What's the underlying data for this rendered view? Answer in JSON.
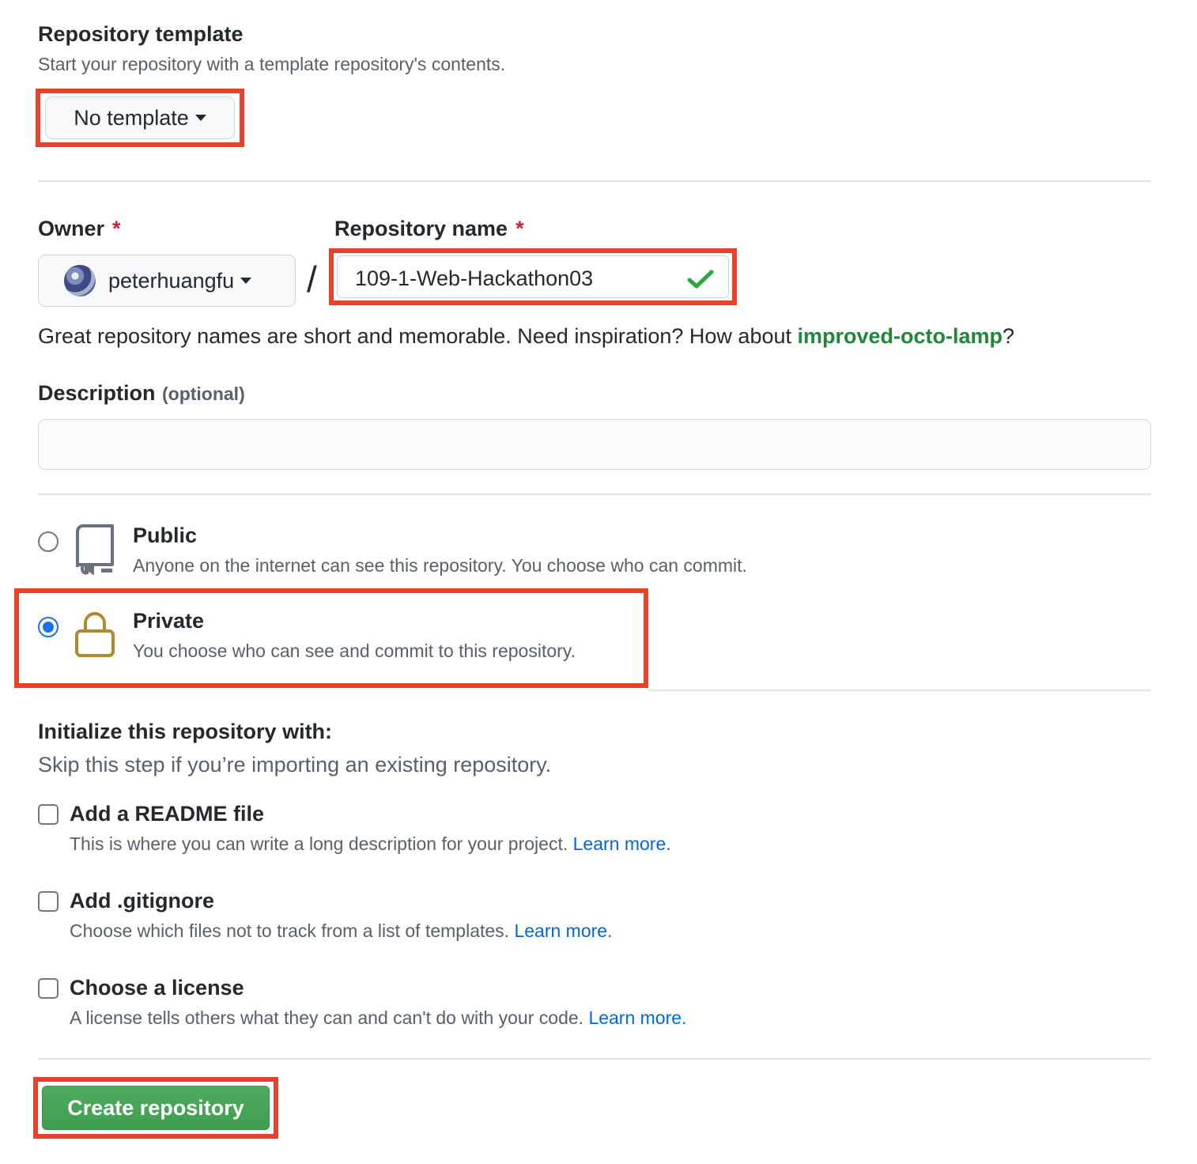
{
  "template_section": {
    "title": "Repository template",
    "description": "Start your repository with a template repository's contents.",
    "dropdown_label": "No template"
  },
  "owner": {
    "label": "Owner",
    "required_mark": "*",
    "value": "peterhuangfu"
  },
  "separator": "/",
  "repo_name": {
    "label": "Repository name",
    "required_mark": "*",
    "value": "109-1-Web-Hackathon03"
  },
  "name_hint": {
    "prefix": "Great repository names are short and memorable. Need inspiration? How about ",
    "suggestion": "improved-octo-lamp",
    "suffix": "?"
  },
  "description": {
    "label": "Description",
    "optional": "(optional)",
    "value": ""
  },
  "visibility": {
    "public": {
      "title": "Public",
      "description": "Anyone on the internet can see this repository. You choose who can commit.",
      "icon": "repo-book-icon",
      "checked": false
    },
    "private": {
      "title": "Private",
      "description": "You choose who can see and commit to this repository.",
      "icon": "lock-icon",
      "checked": true
    }
  },
  "initialize": {
    "title": "Initialize this repository with:",
    "subtitle": "Skip this step if you’re importing an existing repository.",
    "options": [
      {
        "title": "Add a README file",
        "description": "This is where you can write a long description for your project.",
        "link": "Learn more.",
        "checked": false
      },
      {
        "title": "Add .gitignore",
        "description": "Choose which files not to track from a list of templates.",
        "link": "Learn more.",
        "checked": false
      },
      {
        "title": "Choose a license",
        "description": "A license tells others what they can and can't do with your code.",
        "link": "Learn more.",
        "checked": false
      }
    ]
  },
  "submit": {
    "label": "Create repository"
  },
  "colors": {
    "highlight": "#e8412c",
    "primary_button": "#4fac5f",
    "link": "#0366d6",
    "suggestion": "#22863a",
    "required": "#cb2431",
    "lock": "#b08a2e"
  }
}
